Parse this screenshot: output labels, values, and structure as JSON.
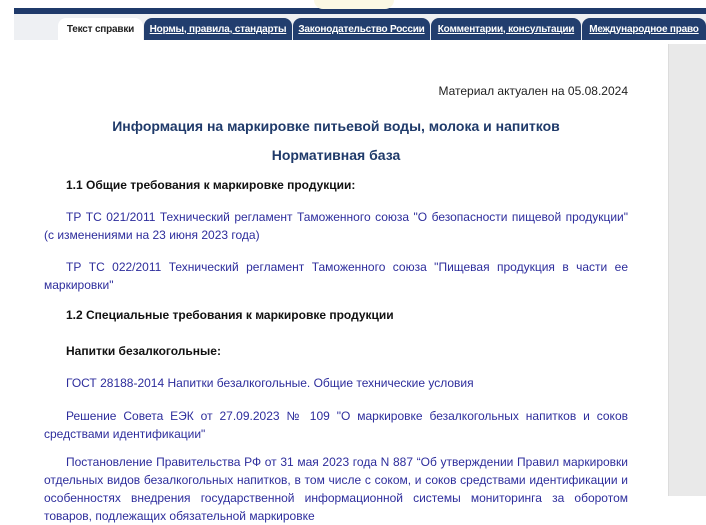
{
  "tabs": [
    {
      "label": "Текст справки",
      "active": true
    },
    {
      "label": "Нормы, правила, стандарты"
    },
    {
      "label": "Законодательство России"
    },
    {
      "label": "Комментарии, консультации"
    },
    {
      "label": "Международное право"
    }
  ],
  "doc": {
    "actual_date": "Материал актуален на 05.08.2024",
    "title": "Информация на маркировке питьевой воды, молока и напитков",
    "subtitle": "Нормативная база",
    "section1": "1.1 Общие требования к маркировке продукции:",
    "p1": "ТР ТС 021/2011 Технический регламент Таможенного союза \"О безопасности пищевой продукции\" (с изменениями на 23 июня 2023 года)",
    "p2": "ТР ТС 022/2011 Технический регламент Таможенного союза \"Пищевая продукция в части ее маркировки\"",
    "section2": "1.2 Специальные требования к маркировке продукции",
    "subsection": "Напитки безалкогольные:",
    "p3": "ГОСТ 28188-2014 Напитки безалкогольные. Общие технические условия",
    "p4": "Решение Совета ЕЭК от 27.09.2023 № 109 \"О маркировке безалкогольных напитков и соков средствами идентификации\"",
    "p5": "Постановление Правительства РФ от 31 мая 2023 года N 887 “Об утверждении Правил маркировки отдельных видов безалкогольных напитков, в том числе с соком, и соков средствами идентификации и особенностях внедрения государственной информационной системы мониторинга за оборотом товаров, подлежащих обязательной маркировке"
  },
  "colors": {
    "tab": "#223e6e",
    "link": "#2d2d9c"
  }
}
